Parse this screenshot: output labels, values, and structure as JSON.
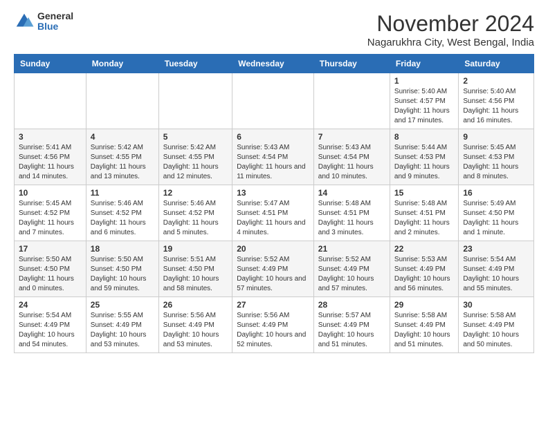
{
  "logo": {
    "general": "General",
    "blue": "Blue"
  },
  "title": "November 2024",
  "subtitle": "Nagarukhra City, West Bengal, India",
  "weekdays": [
    "Sunday",
    "Monday",
    "Tuesday",
    "Wednesday",
    "Thursday",
    "Friday",
    "Saturday"
  ],
  "weeks": [
    [
      {
        "day": "",
        "info": ""
      },
      {
        "day": "",
        "info": ""
      },
      {
        "day": "",
        "info": ""
      },
      {
        "day": "",
        "info": ""
      },
      {
        "day": "",
        "info": ""
      },
      {
        "day": "1",
        "info": "Sunrise: 5:40 AM\nSunset: 4:57 PM\nDaylight: 11 hours and 17 minutes."
      },
      {
        "day": "2",
        "info": "Sunrise: 5:40 AM\nSunset: 4:56 PM\nDaylight: 11 hours and 16 minutes."
      }
    ],
    [
      {
        "day": "3",
        "info": "Sunrise: 5:41 AM\nSunset: 4:56 PM\nDaylight: 11 hours and 14 minutes."
      },
      {
        "day": "4",
        "info": "Sunrise: 5:42 AM\nSunset: 4:55 PM\nDaylight: 11 hours and 13 minutes."
      },
      {
        "day": "5",
        "info": "Sunrise: 5:42 AM\nSunset: 4:55 PM\nDaylight: 11 hours and 12 minutes."
      },
      {
        "day": "6",
        "info": "Sunrise: 5:43 AM\nSunset: 4:54 PM\nDaylight: 11 hours and 11 minutes."
      },
      {
        "day": "7",
        "info": "Sunrise: 5:43 AM\nSunset: 4:54 PM\nDaylight: 11 hours and 10 minutes."
      },
      {
        "day": "8",
        "info": "Sunrise: 5:44 AM\nSunset: 4:53 PM\nDaylight: 11 hours and 9 minutes."
      },
      {
        "day": "9",
        "info": "Sunrise: 5:45 AM\nSunset: 4:53 PM\nDaylight: 11 hours and 8 minutes."
      }
    ],
    [
      {
        "day": "10",
        "info": "Sunrise: 5:45 AM\nSunset: 4:52 PM\nDaylight: 11 hours and 7 minutes."
      },
      {
        "day": "11",
        "info": "Sunrise: 5:46 AM\nSunset: 4:52 PM\nDaylight: 11 hours and 6 minutes."
      },
      {
        "day": "12",
        "info": "Sunrise: 5:46 AM\nSunset: 4:52 PM\nDaylight: 11 hours and 5 minutes."
      },
      {
        "day": "13",
        "info": "Sunrise: 5:47 AM\nSunset: 4:51 PM\nDaylight: 11 hours and 4 minutes."
      },
      {
        "day": "14",
        "info": "Sunrise: 5:48 AM\nSunset: 4:51 PM\nDaylight: 11 hours and 3 minutes."
      },
      {
        "day": "15",
        "info": "Sunrise: 5:48 AM\nSunset: 4:51 PM\nDaylight: 11 hours and 2 minutes."
      },
      {
        "day": "16",
        "info": "Sunrise: 5:49 AM\nSunset: 4:50 PM\nDaylight: 11 hours and 1 minute."
      }
    ],
    [
      {
        "day": "17",
        "info": "Sunrise: 5:50 AM\nSunset: 4:50 PM\nDaylight: 11 hours and 0 minutes."
      },
      {
        "day": "18",
        "info": "Sunrise: 5:50 AM\nSunset: 4:50 PM\nDaylight: 10 hours and 59 minutes."
      },
      {
        "day": "19",
        "info": "Sunrise: 5:51 AM\nSunset: 4:50 PM\nDaylight: 10 hours and 58 minutes."
      },
      {
        "day": "20",
        "info": "Sunrise: 5:52 AM\nSunset: 4:49 PM\nDaylight: 10 hours and 57 minutes."
      },
      {
        "day": "21",
        "info": "Sunrise: 5:52 AM\nSunset: 4:49 PM\nDaylight: 10 hours and 57 minutes."
      },
      {
        "day": "22",
        "info": "Sunrise: 5:53 AM\nSunset: 4:49 PM\nDaylight: 10 hours and 56 minutes."
      },
      {
        "day": "23",
        "info": "Sunrise: 5:54 AM\nSunset: 4:49 PM\nDaylight: 10 hours and 55 minutes."
      }
    ],
    [
      {
        "day": "24",
        "info": "Sunrise: 5:54 AM\nSunset: 4:49 PM\nDaylight: 10 hours and 54 minutes."
      },
      {
        "day": "25",
        "info": "Sunrise: 5:55 AM\nSunset: 4:49 PM\nDaylight: 10 hours and 53 minutes."
      },
      {
        "day": "26",
        "info": "Sunrise: 5:56 AM\nSunset: 4:49 PM\nDaylight: 10 hours and 53 minutes."
      },
      {
        "day": "27",
        "info": "Sunrise: 5:56 AM\nSunset: 4:49 PM\nDaylight: 10 hours and 52 minutes."
      },
      {
        "day": "28",
        "info": "Sunrise: 5:57 AM\nSunset: 4:49 PM\nDaylight: 10 hours and 51 minutes."
      },
      {
        "day": "29",
        "info": "Sunrise: 5:58 AM\nSunset: 4:49 PM\nDaylight: 10 hours and 51 minutes."
      },
      {
        "day": "30",
        "info": "Sunrise: 5:58 AM\nSunset: 4:49 PM\nDaylight: 10 hours and 50 minutes."
      }
    ]
  ]
}
